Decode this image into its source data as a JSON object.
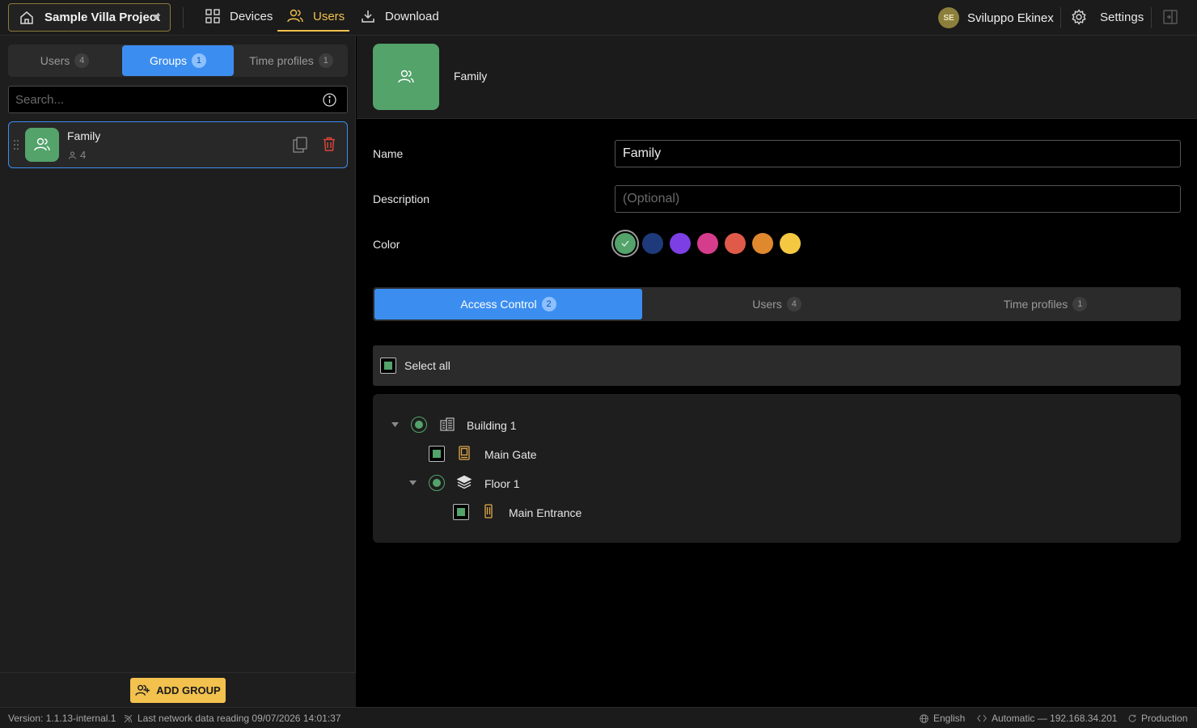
{
  "topbar": {
    "project_name": "Sample Villa Project",
    "nav": {
      "devices": "Devices",
      "users": "Users",
      "download": "Download"
    },
    "user": {
      "initials": "SE",
      "name": "Sviluppo Ekinex"
    },
    "settings": "Settings"
  },
  "left": {
    "tabs": [
      {
        "label": "Users",
        "count": "4"
      },
      {
        "label": "Groups",
        "count": "1"
      },
      {
        "label": "Time profiles",
        "count": "1"
      }
    ],
    "search_placeholder": "Search...",
    "groups": [
      {
        "name": "Family",
        "members": "4"
      }
    ],
    "add_button": "ADD GROUP"
  },
  "detail": {
    "title": "Family",
    "fields": {
      "name_label": "Name",
      "name_value": "Family",
      "description_label": "Description",
      "description_placeholder": "(Optional)",
      "color_label": "Color"
    },
    "colors": [
      "#53a36a",
      "#1e3a7a",
      "#7b3fe4",
      "#d63c8c",
      "#e05a4a",
      "#e0882e",
      "#f5c842"
    ],
    "selected_color": "#53a36a",
    "tabs": [
      {
        "label": "Access Control",
        "count": "2"
      },
      {
        "label": "Users",
        "count": "4"
      },
      {
        "label": "Time profiles",
        "count": "1"
      }
    ],
    "select_all": "Select all",
    "tree": {
      "building": "Building 1",
      "main_gate": "Main Gate",
      "floor": "Floor 1",
      "main_entrance": "Main Entrance"
    }
  },
  "status": {
    "version": "Version: 1.1.13-internal.1",
    "last_reading": "Last network data reading 09/07/2026 14:01:37",
    "language": "English",
    "network": "Automatic — 192.168.34.201",
    "environment": "Production"
  },
  "accent_colors": {
    "primary_blue": "#3b8ef0",
    "brand_yellow": "#f2c14e",
    "group_green": "#53a36a",
    "danger_red": "#e0453a"
  }
}
